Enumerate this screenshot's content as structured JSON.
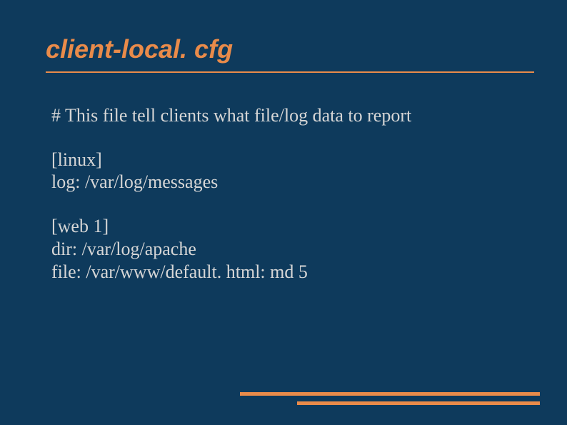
{
  "title": "client-local. cfg",
  "comment": "# This file tell clients what file/log data to report",
  "block1": {
    "section": "[linux]",
    "line1": "log: /var/log/messages"
  },
  "block2": {
    "section": "[web 1]",
    "line1": "dir: /var/log/apache",
    "line2": "file: /var/www/default. html: md 5"
  },
  "colors": {
    "background": "#0e3a5c",
    "accent": "#e98b4a",
    "text": "#d6d6d6"
  }
}
